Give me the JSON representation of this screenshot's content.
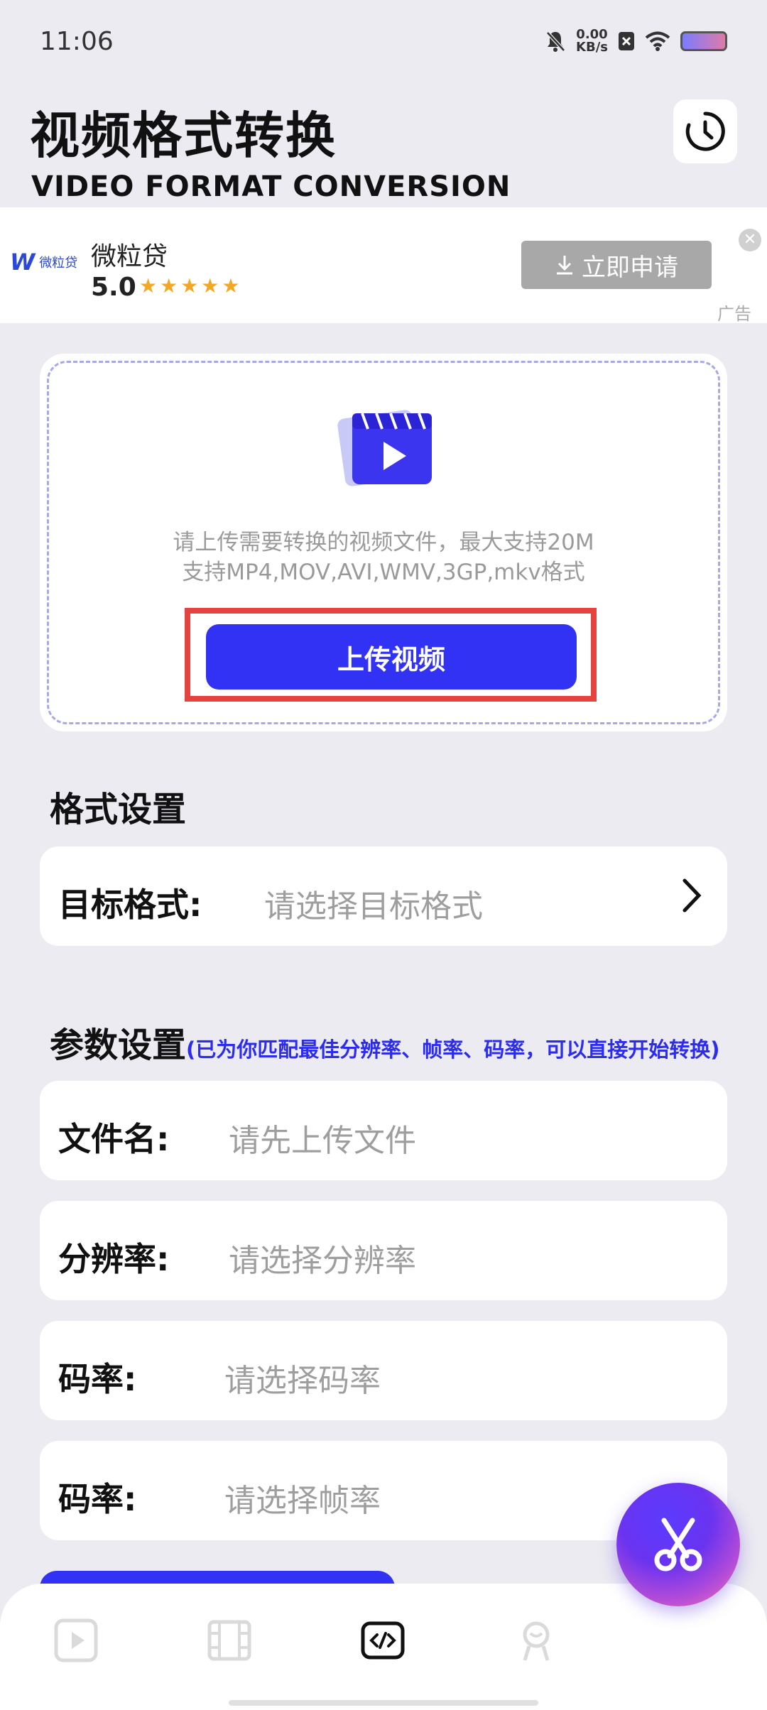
{
  "status_bar": {
    "time": "11:06",
    "net_speed_value": "0.00",
    "net_speed_unit": "KB/s"
  },
  "header": {
    "title": "视频格式转换",
    "subtitle": "VIDEO FORMAT CONVERSION"
  },
  "ad": {
    "logo_text": "微粒贷",
    "name": "微粒贷",
    "rating": "5.0",
    "stars": "★★★★★",
    "cta_label": "立即申请",
    "label": "广告"
  },
  "upload": {
    "desc_line1": "请上传需要转换的视频文件，最大支持20M",
    "desc_line2": "支持MP4,MOV,AVI,WMV,3GP,mkv格式",
    "button_label": "上传视频"
  },
  "format_section": {
    "title": "格式设置",
    "target_label": "目标格式:",
    "target_placeholder": "请选择目标格式"
  },
  "params_section": {
    "title": "参数设置",
    "hint": "(已为你匹配最佳分辨率、帧率、码率，可以直接开始转换)",
    "rows": [
      {
        "label": "文件名:",
        "placeholder": "请先上传文件"
      },
      {
        "label": "分辨率:",
        "placeholder": "请选择分辨率"
      },
      {
        "label": "码率:",
        "placeholder": "请选择码率"
      },
      {
        "label": "码率:",
        "placeholder": "请选择帧率"
      }
    ]
  },
  "tabs": [
    {
      "icon": "play-icon",
      "active": false
    },
    {
      "icon": "film-icon",
      "active": false
    },
    {
      "icon": "code-icon",
      "active": true
    },
    {
      "icon": "profile-icon",
      "active": false
    }
  ],
  "fab": {
    "icon": "scissors-icon"
  },
  "colors": {
    "accent": "#3232f5",
    "highlight_border": "#e6423f",
    "background": "#ebebf1"
  }
}
